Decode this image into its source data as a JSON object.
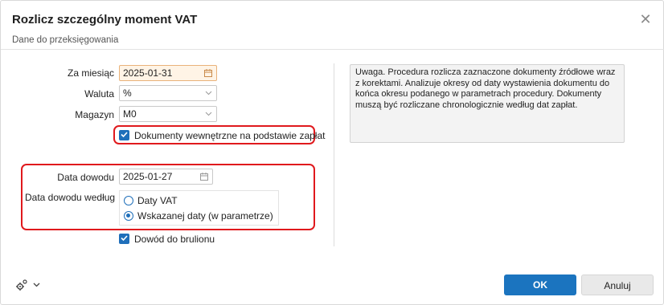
{
  "dialog": {
    "title": "Rozlicz szczególny moment VAT",
    "close_glyph": "✕",
    "subtitle": "Dane do przeksięgowania"
  },
  "form": {
    "za_miesiac": {
      "label": "Za miesiąc",
      "value": "2025-01-31"
    },
    "waluta": {
      "label": "Waluta",
      "value": "%"
    },
    "magazyn": {
      "label": "Magazyn",
      "value": "M0"
    },
    "dokumenty_wewnetrzne": {
      "label": "Dokumenty wewnętrzne na podstawie zapłat",
      "checked": true
    },
    "data_dowodu": {
      "label": "Data dowodu",
      "value": "2025-01-27"
    },
    "data_dowodu_wedlug": {
      "label": "Data dowodu według",
      "options": [
        {
          "label": "Daty VAT",
          "selected": false
        },
        {
          "label": "Wskazanej daty (w parametrze)",
          "selected": true
        }
      ]
    },
    "dowod_do_brulionu": {
      "label": "Dowód do brulionu",
      "checked": true
    }
  },
  "note": {
    "text": "Uwaga. Procedura rozlicza zaznaczone dokumenty źródłowe wraz z korektami.  Analizuje okresy od daty wystawienia dokumentu do końca okresu podanego w parametrach procedury.  Dokumenty muszą być rozliczane chronologicznie według dat zapłat."
  },
  "footer": {
    "ok_label": "OK",
    "cancel_label": "Anuluj"
  },
  "icons": {
    "calendar": "calendar-icon",
    "dropdown": "chevron-down-icon",
    "settings": "gear-icon",
    "check": "check-icon"
  },
  "colors": {
    "accent": "#1b74bf",
    "highlight_border": "#e0191d",
    "highlight_field": "#fff4e6"
  }
}
